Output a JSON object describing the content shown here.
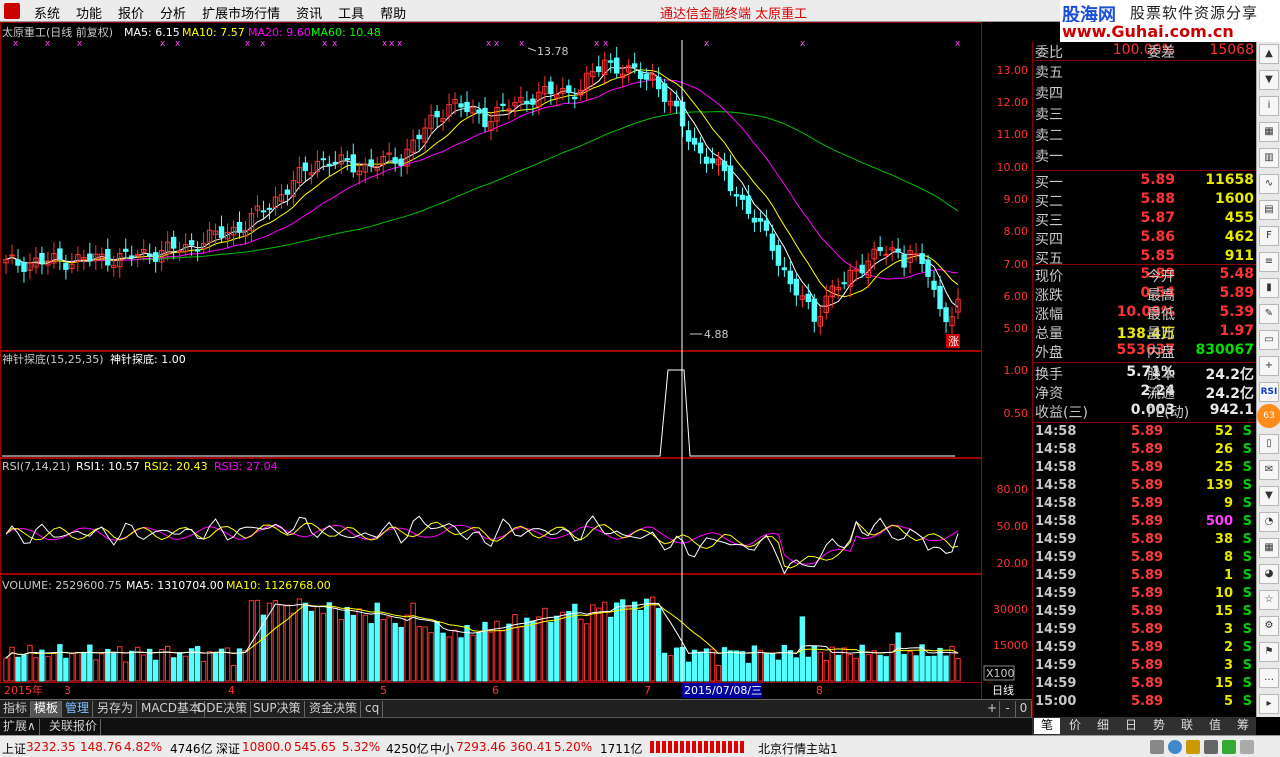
{
  "menubar": {
    "items": [
      "系统",
      "功能",
      "报价",
      "分析",
      "扩展市场行情",
      "资讯",
      "工具",
      "帮助"
    ],
    "center": "通达信金融终端  太原重工",
    "brand_main": "股海网",
    "brand_sub": "股票软件资源分享",
    "brand_url": "www.Guhai.com.cn"
  },
  "chart": {
    "main_title": "太原重工(日线 前复权)",
    "ma5": "MA5: 6.15",
    "ma10": "MA10: 7.57",
    "ma20": "MA20: 9.60",
    "ma60": "MA60: 10.48",
    "high_label": "13.78",
    "low_label": "4.88",
    "zhang_label": "涨",
    "price_ticks": [
      "13.00",
      "12.00",
      "11.00",
      "10.00",
      "9.00",
      "8.00",
      "7.00",
      "6.00",
      "5.00"
    ],
    "ind1_title": "神针探底(15,25,35)",
    "ind1_value": "神针探底: 1.00",
    "ind1_ticks": [
      "1.00",
      "0.50"
    ],
    "rsi_title": "RSI(7,14,21)",
    "rsi1": "RSI1: 10.57",
    "rsi2": "RSI2: 20.43",
    "rsi3": "RSI3: 27.04",
    "rsi_ticks": [
      "80.00",
      "50.00",
      "20.00"
    ],
    "vol_title": "VOLUME: 2529600.75",
    "vol_ma5": "MA5: 1310704.00",
    "vol_ma10": "MA10: 1126768.00",
    "vol_ticks": [
      "30000",
      "15000"
    ],
    "vol_unit": "X100",
    "xaxis": [
      "2015年",
      "3",
      "4",
      "5",
      "6",
      "7",
      "8"
    ],
    "cursor_date": "2015/07/08/三",
    "period": "日线"
  },
  "colors": {
    "up": "#ff3232",
    "down": "#54ffff",
    "ma5": "#ffffff",
    "ma10": "#ffff00",
    "ma20": "#ff00ff",
    "ma60": "#00c000"
  },
  "quote": {
    "weibi_label": "委比",
    "weibi_value": "100.00%",
    "weicha_label": "委差",
    "weicha_value": "15068",
    "asks": [
      {
        "label": "卖五",
        "price": "",
        "vol": ""
      },
      {
        "label": "卖四",
        "price": "",
        "vol": ""
      },
      {
        "label": "卖三",
        "price": "",
        "vol": ""
      },
      {
        "label": "卖二",
        "price": "",
        "vol": ""
      },
      {
        "label": "卖一",
        "price": "",
        "vol": ""
      }
    ],
    "bids": [
      {
        "label": "买一",
        "price": "5.89",
        "vol": "11658"
      },
      {
        "label": "买二",
        "price": "5.88",
        "vol": "1600"
      },
      {
        "label": "买三",
        "price": "5.87",
        "vol": "455"
      },
      {
        "label": "买四",
        "price": "5.86",
        "vol": "462"
      },
      {
        "label": "买五",
        "price": "5.85",
        "vol": "911"
      }
    ],
    "stats": [
      {
        "l1": "现价",
        "v1": "5.89",
        "l2": "今开",
        "v2": "5.48"
      },
      {
        "l1": "涨跌",
        "v1": "0.54",
        "l2": "最高",
        "v2": "5.89"
      },
      {
        "l1": "涨幅",
        "v1": "10.09%",
        "l2": "最低",
        "v2": "5.39"
      },
      {
        "l1": "总量",
        "v1": "138.4万",
        "l2": "量比",
        "v2": "1.97"
      },
      {
        "l1": "外盘",
        "v1": "553637",
        "l2": "内盘",
        "v2": "830067"
      }
    ],
    "stats2": [
      {
        "l1": "换手",
        "v1": "5.71%",
        "l2": "股本",
        "v2": "24.2亿"
      },
      {
        "l1": "净资",
        "v1": "2.24",
        "l2": "流通",
        "v2": "24.2亿"
      },
      {
        "l1": "收益(三)",
        "v1": "0.003",
        "l2": "PE(动)",
        "v2": "942.1"
      }
    ],
    "ticks": [
      {
        "t": "14:58",
        "p": "5.89",
        "v": "52",
        "s": "S"
      },
      {
        "t": "14:58",
        "p": "5.89",
        "v": "26",
        "s": "S"
      },
      {
        "t": "14:58",
        "p": "5.89",
        "v": "25",
        "s": "S"
      },
      {
        "t": "14:58",
        "p": "5.89",
        "v": "139",
        "s": "S"
      },
      {
        "t": "14:58",
        "p": "5.89",
        "v": "9",
        "s": "S"
      },
      {
        "t": "14:58",
        "p": "5.89",
        "v": "500",
        "s": "S"
      },
      {
        "t": "14:59",
        "p": "5.89",
        "v": "38",
        "s": "S"
      },
      {
        "t": "14:59",
        "p": "5.89",
        "v": "8",
        "s": "S"
      },
      {
        "t": "14:59",
        "p": "5.89",
        "v": "1",
        "s": "S"
      },
      {
        "t": "14:59",
        "p": "5.89",
        "v": "10",
        "s": "S"
      },
      {
        "t": "14:59",
        "p": "5.89",
        "v": "15",
        "s": "S"
      },
      {
        "t": "14:59",
        "p": "5.89",
        "v": "3",
        "s": "S"
      },
      {
        "t": "14:59",
        "p": "5.89",
        "v": "2",
        "s": "S"
      },
      {
        "t": "14:59",
        "p": "5.89",
        "v": "3",
        "s": "S"
      },
      {
        "t": "14:59",
        "p": "5.89",
        "v": "15",
        "s": "S"
      },
      {
        "t": "15:00",
        "p": "5.89",
        "v": "5",
        "s": "S"
      }
    ],
    "tabs": [
      "笔",
      "价",
      "细",
      "日",
      "势",
      "联",
      "值",
      "筹"
    ]
  },
  "bottom_tabs": [
    "指标",
    "模板",
    "管理",
    "另存为",
    "MACD基本",
    "DDE决策",
    "SUP决策",
    "资金决策",
    "cq"
  ],
  "bottom_tabs2": [
    "扩展∧",
    "关联报价"
  ],
  "bottom_ctrl": [
    "+",
    "-",
    "0"
  ],
  "status": {
    "sh_label": "上证",
    "sh_value": "3232.35",
    "sh_chg": "148.76",
    "sh_pct": "4.82%",
    "sh_amt": "4746亿",
    "sz_label": "深证",
    "sz_value": "10800.0",
    "sz_chg": "545.65",
    "sz_pct": "5.32%",
    "sz_amt": "4250亿",
    "zx_label": "中小",
    "zx_value": "7293.46",
    "zx_chg": "360.41",
    "zx_pct": "5.20%",
    "zx_amt": "1711亿",
    "station": "北京行情主站1"
  },
  "right_tools": [
    "RSI",
    "63"
  ]
}
